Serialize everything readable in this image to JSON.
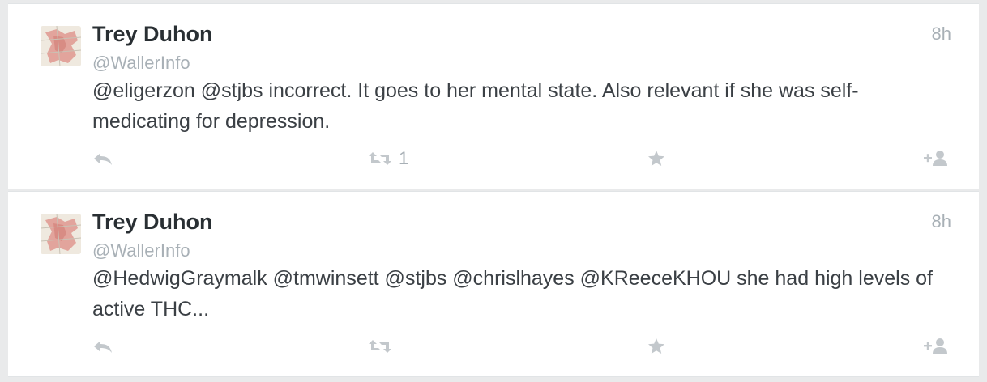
{
  "tweets": [
    {
      "name": "Trey Duhon",
      "handle": "@WallerInfo",
      "time": "8h",
      "text": "@eligerzon @stjbs incorrect.  It goes to her mental state.   Also relevant if she was self-medicating for depression.",
      "retweet_count": "1",
      "icons": {
        "avatar": "map-avatar",
        "reply": "reply-icon",
        "retweet": "retweet-icon",
        "favorite": "star-icon",
        "follow": "follow-icon"
      }
    },
    {
      "name": "Trey Duhon",
      "handle": "@WallerInfo",
      "time": "8h",
      "text": "@HedwigGraymalk @tmwinsett @stjbs @chrislhayes @KReeceKHOU  she had high levels of active THC...",
      "retweet_count": "",
      "icons": {
        "avatar": "map-avatar",
        "reply": "reply-icon",
        "retweet": "retweet-icon",
        "favorite": "star-icon",
        "follow": "follow-icon"
      }
    }
  ],
  "colors": {
    "name": "#292f33",
    "meta": "#a8b0b6",
    "text": "#3b4045",
    "icon": "#c3c8cc"
  }
}
